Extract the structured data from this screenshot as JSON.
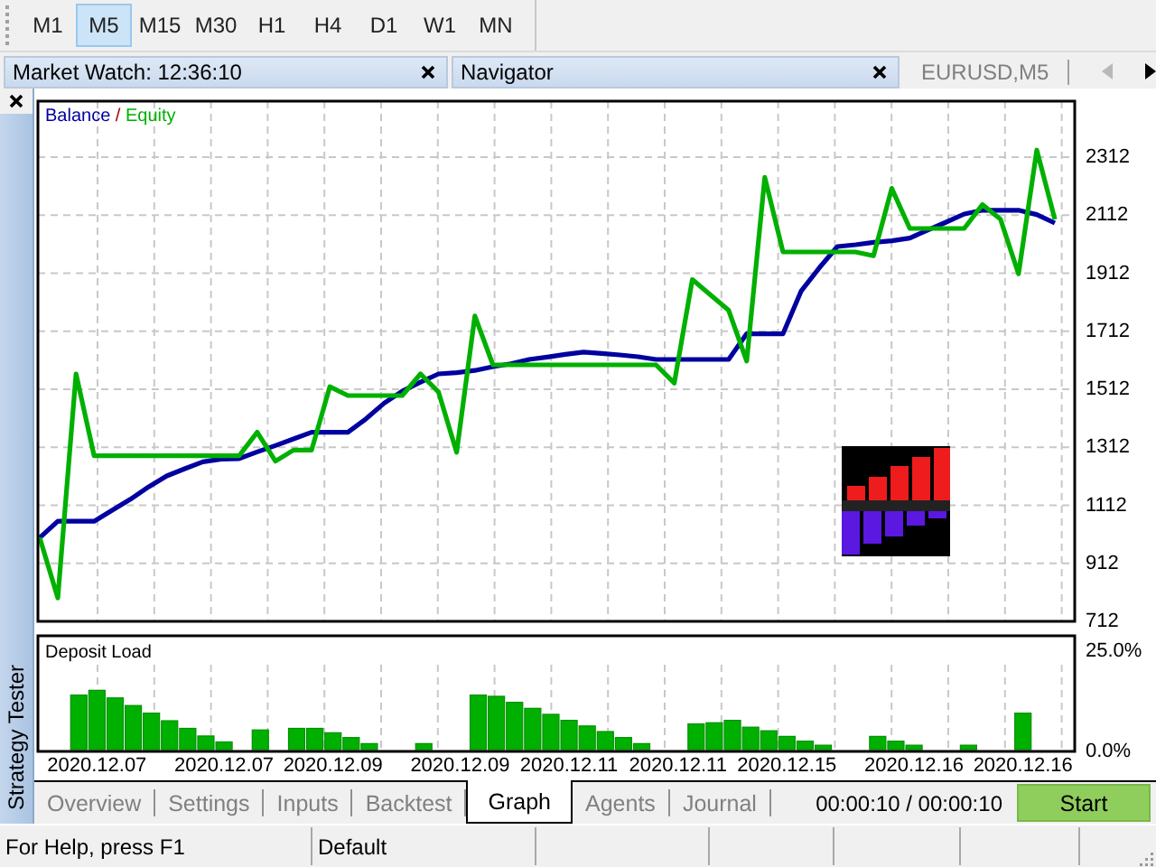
{
  "timeframe_toolbar": {
    "buttons": [
      {
        "label": "M1",
        "selected": false
      },
      {
        "label": "M5",
        "selected": true
      },
      {
        "label": "M15",
        "selected": false
      },
      {
        "label": "M30",
        "selected": false
      },
      {
        "label": "H1",
        "selected": false
      },
      {
        "label": "H4",
        "selected": false
      },
      {
        "label": "D1",
        "selected": false
      },
      {
        "label": "W1",
        "selected": false
      },
      {
        "label": "MN",
        "selected": false
      }
    ]
  },
  "panels": [
    {
      "title": "Market Watch: 12:36:10"
    },
    {
      "title": "Navigator"
    }
  ],
  "chart_tab": {
    "title": "EURUSD,M5"
  },
  "scroll_arrows": [
    {
      "kind": "left",
      "disabled": true
    },
    {
      "kind": "right",
      "disabled": false
    }
  ],
  "strategy_tester": {
    "title": "Strategy Tester",
    "balance_chart": {
      "legend_separator": "/",
      "chart_data": {
        "type": "line",
        "categories": [
          null,
          null,
          null,
          null,
          null,
          null,
          null,
          null,
          null,
          null,
          null,
          null,
          null,
          null,
          null,
          null,
          null,
          null,
          null,
          null,
          null,
          null,
          null,
          null,
          null,
          null,
          null,
          null,
          null,
          null,
          null,
          null,
          null,
          null,
          null,
          null,
          null,
          null,
          null,
          null,
          null,
          null,
          null,
          null,
          null,
          null,
          null,
          null,
          null,
          null,
          null,
          null,
          null,
          null,
          null,
          null,
          null
        ],
        "series": [
          {
            "name": "Balance",
            "color": "#0000a0",
            "values": [
              1000,
              1057,
              1057,
              1057,
              1095,
              1133,
              1175,
              1213,
              1238,
              1262,
              1271,
              1273,
              1296,
              1318,
              1341,
              1364,
              1364,
              1364,
              1410,
              1464,
              1505,
              1536,
              1565,
              1569,
              1577,
              1590,
              1600,
              1615,
              1623,
              1632,
              1640,
              1635,
              1630,
              1624,
              1615,
              1615,
              1615,
              1615,
              1615,
              1703,
              1703,
              1703,
              1850,
              1930,
              2004,
              2010,
              2018,
              2024,
              2033,
              2061,
              2088,
              2116,
              2129,
              2129,
              2129,
              2114,
              2085
            ]
          },
          {
            "name": "Equity",
            "color": "#00b000",
            "values": [
              1000,
              793,
              1565,
              1283,
              1283,
              1283,
              1283,
              1283,
              1283,
              1283,
              1283,
              1283,
              1364,
              1264,
              1302,
              1302,
              1521,
              1490,
              1490,
              1490,
              1490,
              1565,
              1502,
              1295,
              1765,
              1596,
              1596,
              1596,
              1596,
              1596,
              1596,
              1596,
              1596,
              1596,
              1596,
              1533,
              1890,
              1837,
              1784,
              1609,
              2242,
              1985,
              1985,
              1985,
              1985,
              1985,
              1972,
              2204,
              2066,
              2066,
              2066,
              2066,
              2148,
              2098,
              1910,
              2336,
              2098
            ]
          }
        ],
        "grid": true,
        "ylim": [
          712,
          2505
        ],
        "yticks": [
          {
            "value": 712,
            "label": "712"
          },
          {
            "value": 912,
            "label": "912"
          },
          {
            "value": 1112,
            "label": "1112"
          },
          {
            "value": 1312,
            "label": "1312"
          },
          {
            "value": 1512,
            "label": "1512"
          },
          {
            "value": 1712,
            "label": "1712"
          },
          {
            "value": 1912,
            "label": "1912"
          },
          {
            "value": 2112,
            "label": "2112"
          },
          {
            "value": 2312,
            "label": "2312"
          }
        ]
      }
    },
    "deposit_chart": {
      "chart_data": {
        "type": "bar",
        "title": "Deposit Load",
        "categories": [
          null,
          "2020.12.07",
          null,
          null,
          null,
          null,
          null,
          null,
          "2020.12.07",
          null,
          null,
          null,
          null,
          null,
          "2020.12.09",
          null,
          null,
          null,
          null,
          null,
          null,
          "2020.12.09",
          null,
          null,
          null,
          null,
          null,
          "2020.12.11",
          null,
          null,
          null,
          null,
          null,
          "2020.12.11",
          null,
          null,
          null,
          null,
          null,
          "2020.12.15",
          null,
          null,
          null,
          null,
          null,
          null,
          "2020.12.16",
          null,
          null,
          null,
          null,
          null,
          "2020.12.16"
        ],
        "values": [
          13.6,
          14.8,
          12.9,
          11.0,
          9.1,
          7.2,
          5.3,
          3.4,
          1.9,
          null,
          4.9,
          null,
          5.3,
          5.3,
          4.2,
          3.0,
          1.5,
          null,
          null,
          1.5,
          null,
          null,
          13.6,
          13.3,
          11.8,
          10.3,
          8.8,
          7.3,
          5.9,
          4.5,
          3.0,
          1.5,
          null,
          null,
          6.4,
          6.7,
          7.3,
          5.6,
          4.7,
          3.3,
          2.1,
          1.1,
          null,
          null,
          3.3,
          2.1,
          1.1,
          null,
          null,
          1.1,
          null,
          null,
          9.1
        ],
        "grid": true,
        "ylim": [
          0,
          28.4
        ],
        "yticks": [
          {
            "value": 0,
            "label": "0.0%"
          },
          {
            "value": 25,
            "label": "25.0%"
          }
        ]
      }
    },
    "tabs": [
      {
        "label": "Overview",
        "selected": false
      },
      {
        "label": "Settings",
        "selected": false
      },
      {
        "label": "Inputs",
        "selected": false
      },
      {
        "label": "Backtest",
        "selected": false
      },
      {
        "label": "Graph",
        "selected": true
      },
      {
        "label": "Agents",
        "selected": false
      },
      {
        "label": "Journal",
        "selected": false
      }
    ],
    "elapsed": "00:00:10 / 00:00:10",
    "start_button": "Start"
  },
  "status_bar": {
    "panes": [
      "For Help, press F1",
      "Default"
    ]
  }
}
